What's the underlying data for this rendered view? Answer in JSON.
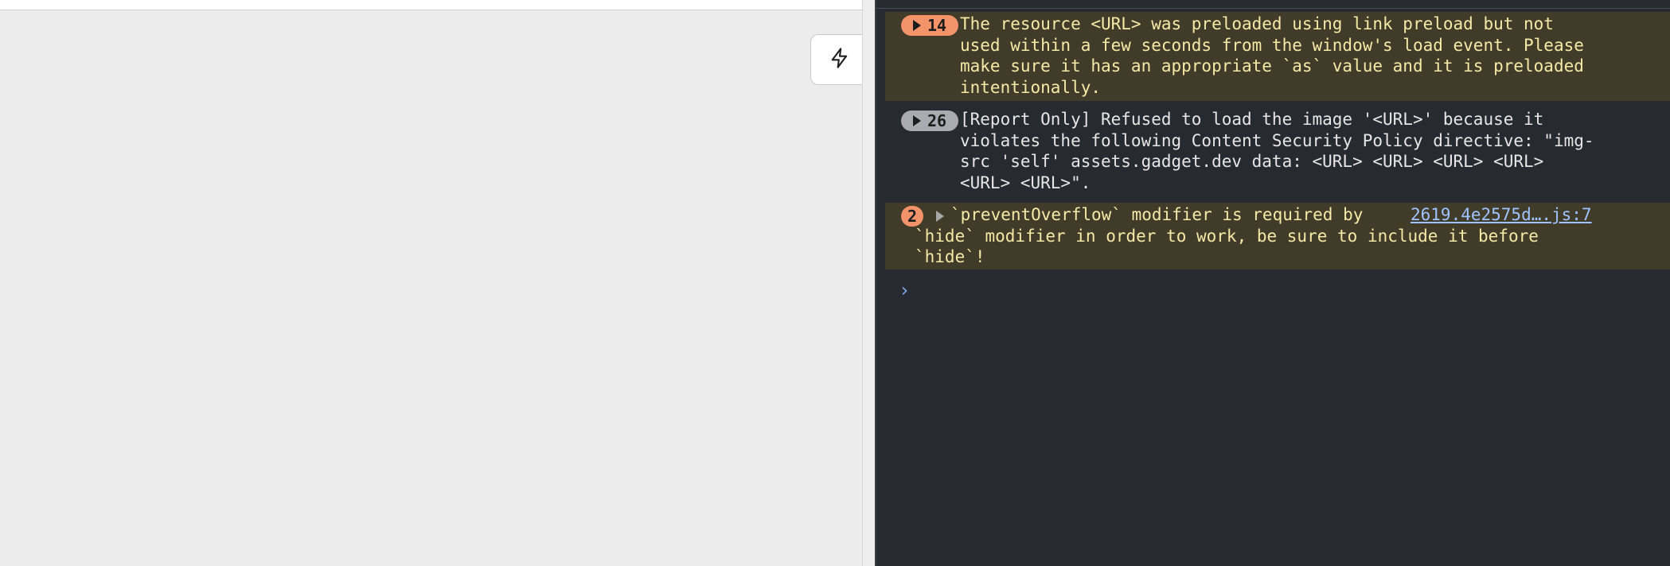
{
  "console": {
    "messages": [
      {
        "level": "warning",
        "count": "14",
        "text": "The resource <URL> was preloaded using link preload but not\nused within a few seconds from the window's load event. Please\nmake sure it has an appropriate `as` value and it is preloaded\nintentionally."
      },
      {
        "level": "info",
        "count": "26",
        "text": "[Report Only] Refused to load the image '<URL>' because it\nviolates the following Content Security Policy directive: \"img-\nsrc 'self' assets.gadget.dev data: <URL> <URL> <URL> <URL>\n<URL> <URL>\"."
      },
      {
        "level": "warning",
        "count": "2",
        "text": "`preventOverflow` modifier is required by\n`hide` modifier in order to work, be sure to include it before\n`hide`!",
        "source": "2619.4e2575d….js:7"
      }
    ],
    "prompt_symbol": "›"
  },
  "colors": {
    "warning_bg": "#413b2a",
    "warning_text": "#f5e9a6",
    "console_bg": "#282a31",
    "badge_warning": "#f3936a",
    "badge_info": "#a9abb0",
    "link": "#9fc4ff"
  },
  "icons": {
    "page_button": "lightning-bolt-icon"
  }
}
